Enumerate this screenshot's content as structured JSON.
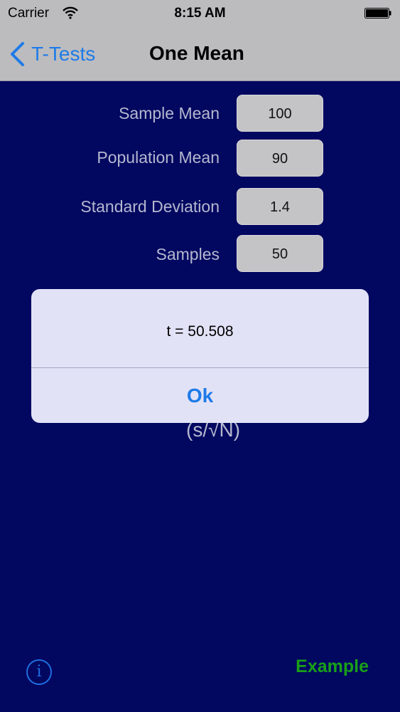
{
  "status_bar": {
    "carrier": "Carrier",
    "time": "8:15 AM"
  },
  "nav": {
    "back_label": "T-Tests",
    "title": "One Mean"
  },
  "form": {
    "fields": [
      {
        "label": "Sample Mean",
        "value": "100"
      },
      {
        "label": "Population Mean",
        "value": "90"
      },
      {
        "label": "Standard Deviation",
        "value": "1.4"
      },
      {
        "label": "Samples",
        "value": "50"
      }
    ]
  },
  "formula_fragment": "(s/√N)",
  "alert": {
    "message": "t = 50.508",
    "ok_label": "Ok"
  },
  "footer": {
    "info_glyph": "i",
    "example_label": "Example"
  },
  "colors": {
    "accent": "#1e7be8",
    "background": "#020760",
    "example": "#18a018"
  },
  "icons": {
    "back": "chevron-left-icon",
    "info": "info-circle-icon",
    "wifi": "wifi-icon",
    "battery": "battery-icon"
  }
}
